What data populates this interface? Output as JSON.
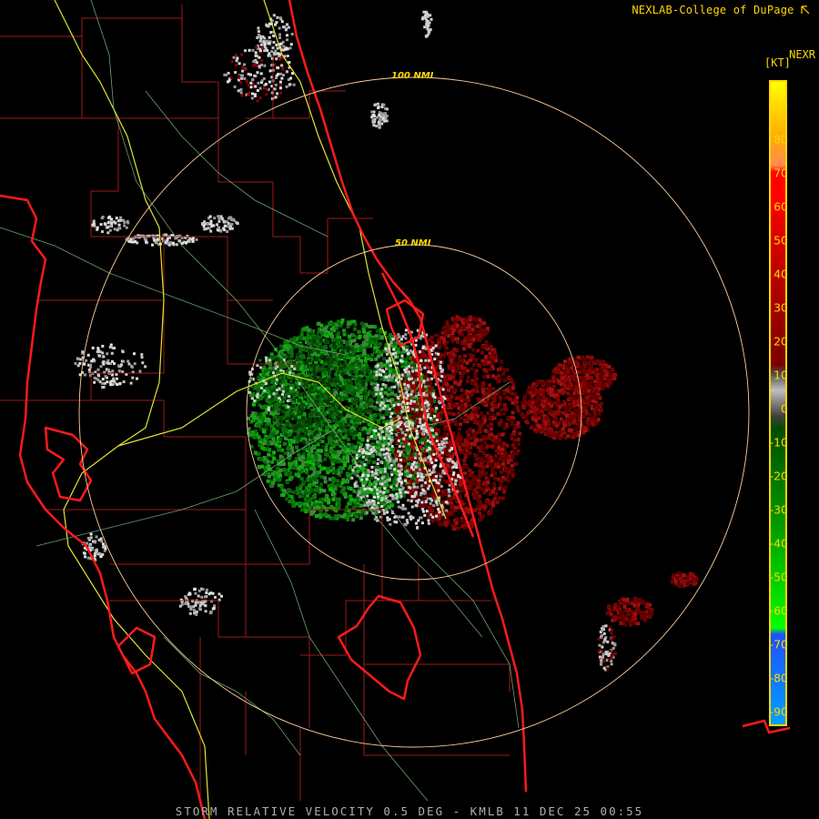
{
  "header": {
    "credit": "NEXLAB-College of DuPage",
    "credit_icon": "cursor-icon"
  },
  "footer": {
    "product": "STORM RELATIVE VELOCITY 0.5 DEG - KMLB 11 DEC 25 00:55"
  },
  "rings": [
    "100 NMI",
    "50 NMI"
  ],
  "legend": {
    "title": "NEXR",
    "unit": "[KT]",
    "ticks": [
      "90",
      "80",
      "70",
      "60",
      "50",
      "40",
      "30",
      "20",
      "10",
      "0",
      "-10",
      "-20",
      "-30",
      "-40",
      "-50",
      "-60",
      "-70",
      "-80",
      "-90"
    ],
    "colors": {
      "top": "#ffff00",
      "orange": "#ff8a50",
      "red": "#ff0000",
      "dark_red": "#7a0000",
      "gray": "#c0c0c0",
      "dark_green": "#004d00",
      "green": "#00ff00",
      "blue": "#1e50ff",
      "light_blue": "#00a0ff"
    }
  }
}
